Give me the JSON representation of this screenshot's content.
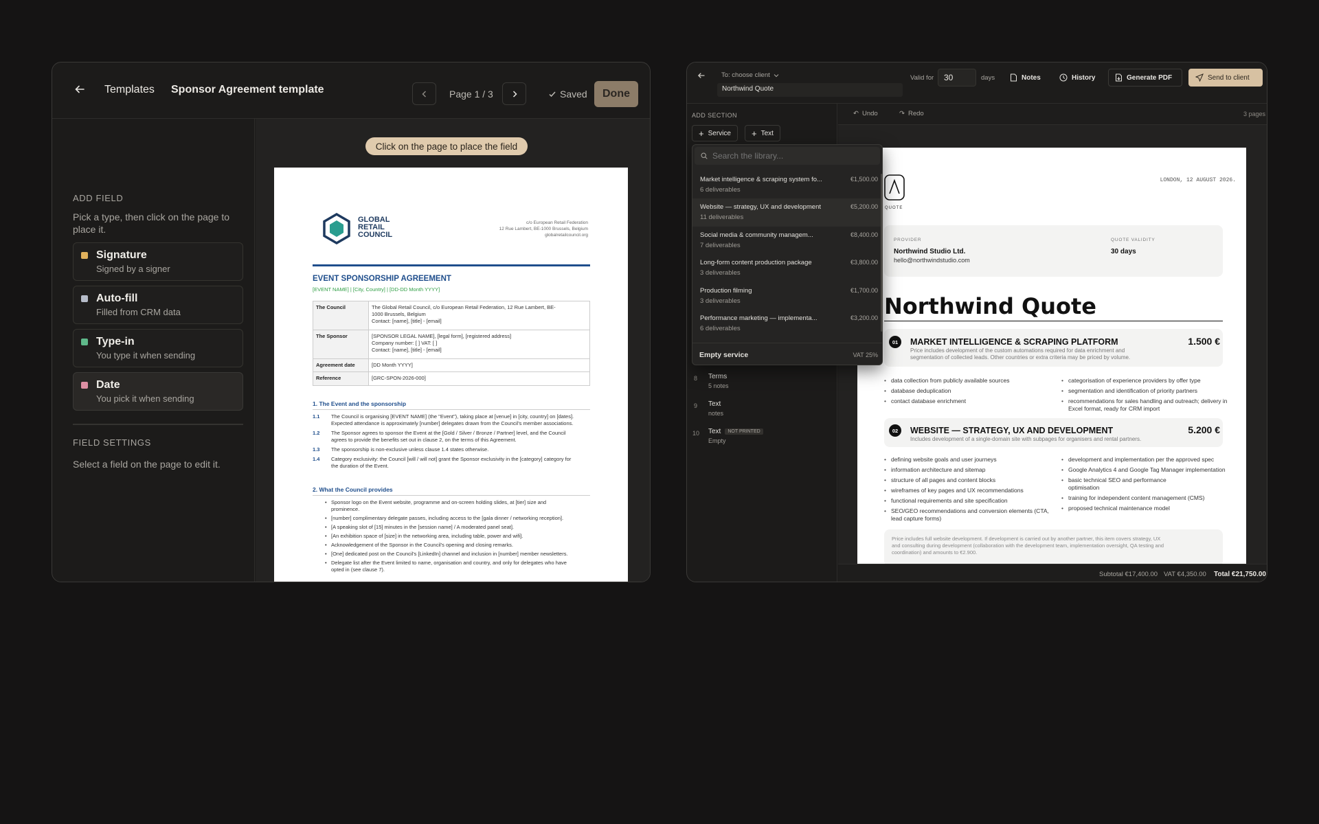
{
  "editor": {
    "back_label": "Templates",
    "template_name": "Sponsor Agreement template",
    "page_indicator": "Page 1 / 3",
    "saved_label": "Saved",
    "done_label": "Done",
    "add_field": {
      "heading": "ADD FIELD",
      "hint": "Pick a type, then click on the page to place it.",
      "types": [
        {
          "title": "Signature",
          "subtitle": "Signed by a signer",
          "color": "#e0b15c"
        },
        {
          "title": "Auto-fill",
          "subtitle": "Filled from CRM data",
          "color": "#b6bcc9"
        },
        {
          "title": "Type-in",
          "subtitle": "You type it when sending",
          "color": "#5fb98a"
        },
        {
          "title": "Date",
          "subtitle": "You pick it when sending",
          "color": "#dd8fa3"
        }
      ]
    },
    "field_settings": {
      "heading": "FIELD SETTINGS",
      "hint": "Select a field on the page to edit it."
    },
    "place_hint": "Click on the page to place the field",
    "doc": {
      "logo_text": [
        "GLOBAL",
        "RETAIL",
        "COUNCIL"
      ],
      "address": [
        "c/o European Retail Federation",
        "12 Rue Lambert, BE-1000 Brussels, Belgium",
        "globalretailcouncil.org"
      ],
      "title": "EVENT SPONSORSHIP AGREEMENT",
      "subtitle": "[EVENT NAME]  |  [City, Country]  |  [DD-DD Month YYYY]",
      "table": [
        {
          "k": "The Council",
          "v": [
            "The Global Retail Council, c/o European Retail Federation, 12 Rue Lambert, BE-",
            "1000 Brussels, Belgium",
            "Contact: [name], [title] - [email]"
          ]
        },
        {
          "k": "The Sponsor",
          "v": [
            "[SPONSOR LEGAL NAME], [legal form], [registered address]",
            "Company number: [ ]   VAT: [ ]",
            "Contact: [name], [title] - [email]"
          ]
        },
        {
          "k": "Agreement date",
          "v": [
            "[DD Month YYYY]"
          ]
        },
        {
          "k": "Reference",
          "v": [
            "[GRC-SPON-2026-000]"
          ]
        }
      ],
      "section1": "1.  The Event and the sponsorship",
      "clauses": [
        {
          "n": "1.1",
          "t": [
            "The Council is organising [EVENT NAME] (the \"Event\"), taking place at [venue] in [city, country] on [dates].",
            "Expected attendance is approximately [number] delegates drawn from the Council's member associations."
          ]
        },
        {
          "n": "1.2",
          "t": [
            "The Sponsor agrees to sponsor the Event at the [Gold / Silver / Bronze / Partner] level, and the Council",
            "agrees to provide the benefits set out in clause 2, on the terms of this Agreement."
          ]
        },
        {
          "n": "1.3",
          "t": [
            "The sponsorship is non-exclusive unless clause 1.4 states otherwise."
          ]
        },
        {
          "n": "1.4",
          "t": [
            "Category exclusivity: the Council [will / will not] grant the Sponsor exclusivity in the [category] category for",
            "the duration of the Event."
          ]
        }
      ],
      "section2": "2.  What the Council provides",
      "bullets": [
        [
          "Sponsor logo on the Event website, programme and on-screen holding slides, at [tier] size and",
          "prominence."
        ],
        [
          "[number] complimentary delegate passes, including access to the [gala dinner / networking reception]."
        ],
        [
          "[A speaking slot of [15] minutes in the [session name] / A moderated panel seat]."
        ],
        [
          "[An exhibition space of [size] in the networking area, including table, power and wifi]."
        ],
        [
          "Acknowledgement of the Sponsor in the Council's opening and closing remarks."
        ],
        [
          "[One] dedicated post on the Council's [LinkedIn] channel and inclusion in [number] member newsletters."
        ],
        [
          "Delegate list after the Event limited to name, organisation and country, and only for delegates who have",
          "opted in (see clause 7)."
        ]
      ]
    }
  },
  "quote": {
    "to_label": "To: choose client",
    "quote_name": "Northwind Quote",
    "valid_for_label": "Valid for",
    "valid_days": "30",
    "days_label": "days",
    "notes_label": "Notes",
    "history_label": "History",
    "generate_label": "Generate PDF",
    "send_label": "Send to client",
    "add_section": "ADD SECTION",
    "service_btn": "Service",
    "text_btn": "Text",
    "undo": "Undo",
    "redo": "Redo",
    "pages": "3 pages",
    "search_placeholder": "Search the library...",
    "library": [
      {
        "name": "Market intelligence & scraping system fo...",
        "count": "6 deliverables",
        "price": "€1,500.00"
      },
      {
        "name": "Website — strategy, UX and development",
        "count": "11 deliverables",
        "price": "€5,200.00"
      },
      {
        "name": "Social media & community managem...",
        "count": "7 deliverables",
        "price": "€8,400.00"
      },
      {
        "name": "Long-form content production package",
        "count": "3 deliverables",
        "price": "€3,800.00"
      },
      {
        "name": "Production filming",
        "count": "3 deliverables",
        "price": "€1,700.00"
      },
      {
        "name": "Performance marketing — implementa...",
        "count": "6 deliverables",
        "price": "€3,200.00"
      }
    ],
    "empty_service": "Empty service",
    "vat": "VAT 25%",
    "sections": [
      {
        "num": "8",
        "title": "Terms",
        "sub": "5 notes",
        "badge": ""
      },
      {
        "num": "9",
        "title": "Text",
        "sub": "notes",
        "badge": ""
      },
      {
        "num": "10",
        "title": "Text",
        "sub": "Empty",
        "badge": "NOT PRINTED"
      }
    ],
    "doc": {
      "date": "LONDON, 12 AUGUST 2026.",
      "logo_caption": "QUOTE",
      "provider_label": "PROVIDER",
      "provider_name": "Northwind Studio Ltd.",
      "provider_email": "hello@northwindstudio.com",
      "validity_label": "QUOTE VALIDITY",
      "validity": "30 days",
      "title": "Northwind Quote",
      "items": [
        {
          "num": "01",
          "title": "MARKET INTELLIGENCE & SCRAPING PLATFORM",
          "price": "1.500 €",
          "desc": [
            "Price includes development of the custom automations required for data enrichment and",
            "segmentation of collected leads. Other countries or extra criteria may be priced by volume."
          ],
          "left": [
            [
              "data collection from publicly available sources"
            ],
            [
              "database deduplication"
            ],
            [
              "contact database enrichment"
            ]
          ],
          "right": [
            [
              "categorisation of experience providers by offer type"
            ],
            [
              "segmentation and identification of priority partners"
            ],
            [
              "recommendations for sales handling and outreach; delivery in",
              "Excel format, ready for CRM import"
            ]
          ]
        },
        {
          "num": "02",
          "title": "WEBSITE — STRATEGY, UX AND DEVELOPMENT",
          "price": "5.200 €",
          "desc": [
            "Includes development of a single-domain site with subpages for organisers and rental partners."
          ],
          "left": [
            [
              "defining website goals and user journeys"
            ],
            [
              "information architecture and sitemap"
            ],
            [
              "structure of all pages and content blocks"
            ],
            [
              "wireframes of key pages and UX recommendations"
            ],
            [
              "functional requirements and site specification"
            ],
            [
              "SEO/GEO recommendations and conversion elements (CTA,",
              "lead capture forms)"
            ]
          ],
          "right": [
            [
              "development and implementation per the approved spec"
            ],
            [
              "Google Analytics 4 and Google Tag Manager implementation"
            ],
            [
              "basic technical SEO and performance",
              "optimisation"
            ],
            [
              "training for independent content management (CMS)"
            ],
            [
              "proposed technical maintenance model"
            ]
          ]
        }
      ],
      "note": [
        "Price includes full website development. If development is carried out by another partner, this item covers strategy, UX",
        "and consulting during development (collaboration with the development team, implementation oversight, QA testing and",
        "coordination) and amounts to €2.900."
      ]
    },
    "subtotal": "Subtotal €17,400.00",
    "vat_total": "VAT €4,350.00",
    "total": "Total €21,750.00"
  }
}
